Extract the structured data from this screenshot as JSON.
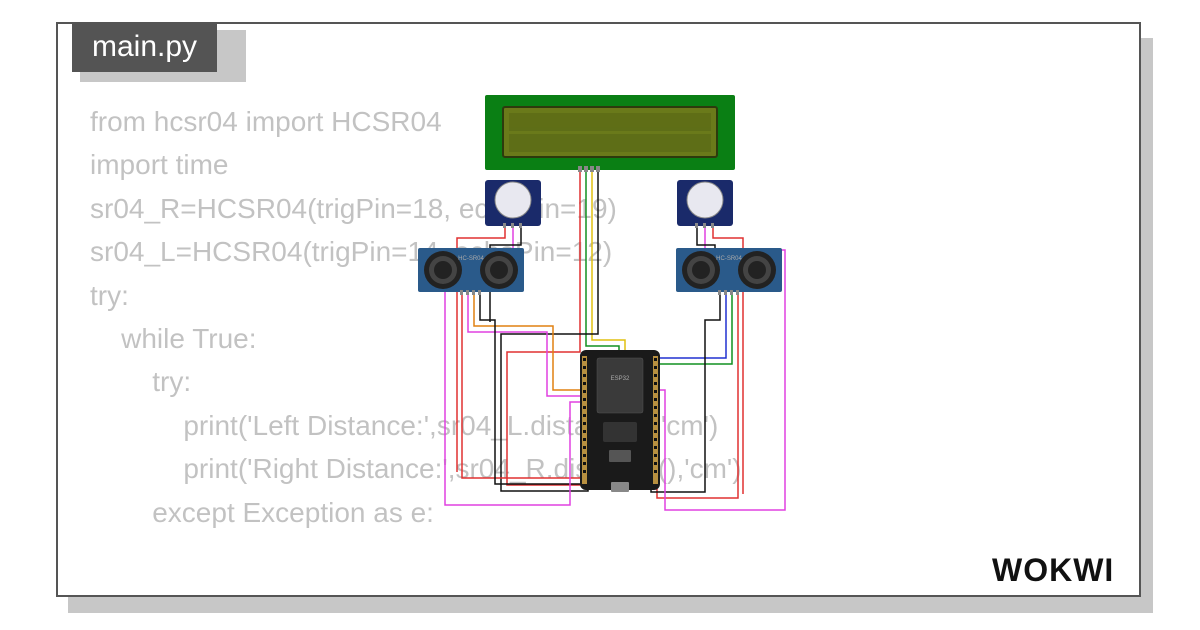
{
  "tab": {
    "filename": "main.py"
  },
  "code": {
    "line1": "from hcsr04 import HCSR04",
    "line2": "import time",
    "line3": "sr04_R=HCSR04(trigPin=18, echoPin=19)",
    "line4": "sr04_L=HCSR04(trigPin=14, echoPin=12)",
    "line5": "try:",
    "line6": "    while True:",
    "line7": "        try:",
    "line8": "            print('Left Distance:',sr04_L.distance(),'cm')",
    "line9": "            print('Right Distance:',sr04_R.distance(),'cm')",
    "line10": "        except Exception as e:"
  },
  "components": {
    "lcd": "LCD1602",
    "pir_left": "PIR",
    "pir_right": "PIR",
    "hcsr_left": "HC-SR04",
    "hcsr_right": "HC-SR04",
    "mcu": "ESP32"
  },
  "brand": "WOKWI"
}
